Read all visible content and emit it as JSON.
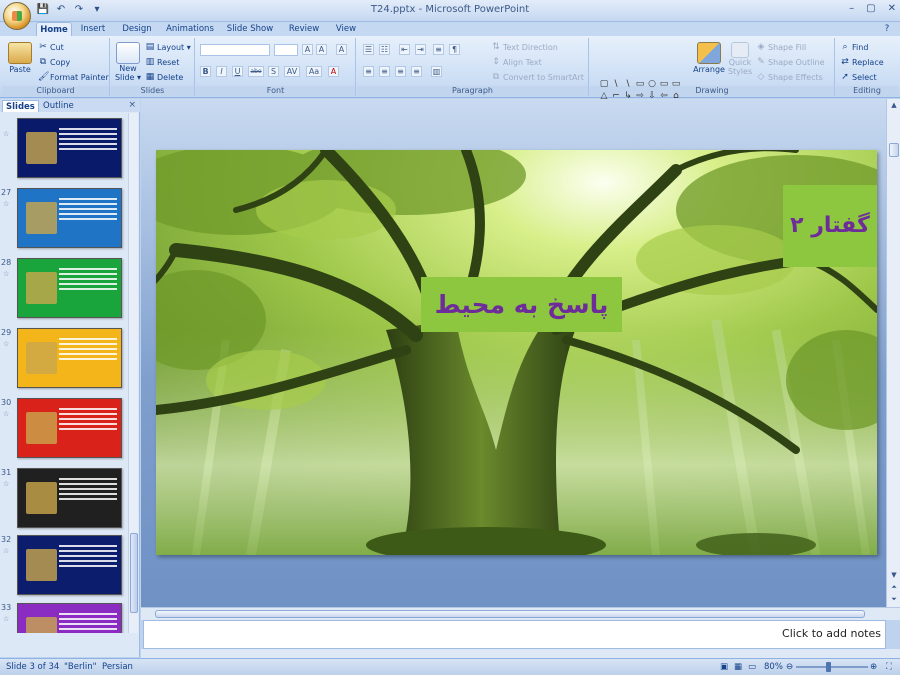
{
  "window": {
    "title": "T24.pptx - Microsoft PowerPoint",
    "controls": [
      "–",
      "▢",
      "✕"
    ]
  },
  "qat": {
    "save_icon": "save-icon",
    "undo_icon": "undo-icon",
    "redo_icon": "redo-icon",
    "customize": "▾"
  },
  "ribbon_tabs": [
    "Home",
    "Insert",
    "Design",
    "Animations",
    "Slide Show",
    "Review",
    "View"
  ],
  "help_icon": "?",
  "clipboard": {
    "paste": "Paste",
    "cut": "Cut",
    "copy": "Copy",
    "format_painter": "Format Painter",
    "label": "Clipboard"
  },
  "slides_group": {
    "new_slide_line1": "New",
    "new_slide_line2": "Slide ▾",
    "layout": "Layout ▾",
    "reset": "Reset",
    "delete": "Delete",
    "label": "Slides"
  },
  "font_group": {
    "label": "Font",
    "bold": "B",
    "italic": "I",
    "underline": "U",
    "strike": "abe",
    "shadow": "S",
    "spacing": "AV",
    "case": "Aa",
    "color": "A",
    "grow": "A",
    "shrink": "A",
    "clear": "A"
  },
  "paragraph_group": {
    "label": "Paragraph",
    "text_direction": "Text Direction",
    "align_text": "Align Text",
    "convert_smartart": "Convert to SmartArt"
  },
  "drawing_group": {
    "label": "Drawing",
    "arrange": "Arrange",
    "quick_styles_line1": "Quick",
    "quick_styles_line2": "Styles",
    "shape_fill": "Shape Fill",
    "shape_outline": "Shape Outline",
    "shape_effects": "Shape Effects",
    "shapes": [
      "▢",
      "\\",
      "\\",
      "▭",
      "○",
      "▭",
      "▭",
      "△",
      "⌐",
      "↳",
      "⇨",
      "⇩",
      "⇦",
      "⌂",
      "↶",
      "⌒",
      "⌒",
      "(",
      ")",
      "☆",
      "⌄"
    ]
  },
  "editing_group": {
    "label": "Editing",
    "find": "Find",
    "replace": "Replace",
    "select": "Select"
  },
  "panel": {
    "tabs": [
      "Slides",
      "Outline"
    ],
    "close": "×",
    "thumbs": [
      {
        "num": "",
        "color": "#0a1a6b"
      },
      {
        "num": "27",
        "color": "#1f74c6"
      },
      {
        "num": "28",
        "color": "#19a43c"
      },
      {
        "num": "29",
        "color": "#f3b51a"
      },
      {
        "num": "30",
        "color": "#d8221a"
      },
      {
        "num": "31",
        "color": "#202020"
      },
      {
        "num": "32",
        "color": "#0c1d6e"
      },
      {
        "num": "33",
        "color": "#8a2bc2"
      }
    ]
  },
  "slide": {
    "title": "پاسخ به محیط",
    "subtitle": "گفتار ۲"
  },
  "notes": {
    "placeholder": "Click to add notes"
  },
  "status": {
    "slide_info": "Slide 3 of 34",
    "theme": "\"Berlin\"",
    "language": "Persian",
    "zoom": "80%"
  },
  "colors": {
    "title_box": "#8dc63f",
    "title_text": "#6d2c9a"
  }
}
